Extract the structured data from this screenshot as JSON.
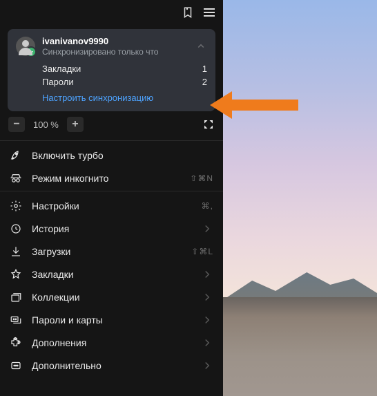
{
  "toolbar": {
    "bookmark_icon": "bookmark-icon",
    "menu_icon": "menu-icon"
  },
  "sync": {
    "username": "ivanivanov9990",
    "status": "Синхронизировано только что",
    "rows": [
      {
        "label": "Закладки",
        "value": "1"
      },
      {
        "label": "Пароли",
        "value": "2"
      }
    ],
    "configure": "Настроить синхронизацию"
  },
  "zoom": {
    "minus": "−",
    "value": "100 %",
    "plus": "+"
  },
  "menu": {
    "turbo": {
      "label": "Включить турбо"
    },
    "incognito": {
      "label": "Режим инкогнито",
      "shortcut": "⇧⌘N"
    },
    "settings": {
      "label": "Настройки",
      "shortcut": "⌘,"
    },
    "history": {
      "label": "История"
    },
    "downloads": {
      "label": "Загрузки",
      "shortcut": "⇧⌘L"
    },
    "bookmarks": {
      "label": "Закладки"
    },
    "collections": {
      "label": "Коллекции"
    },
    "passwords": {
      "label": "Пароли и карты"
    },
    "addons": {
      "label": "Дополнения"
    },
    "more": {
      "label": "Дополнительно"
    }
  },
  "annotation": {
    "highlight_row_index": 1
  }
}
